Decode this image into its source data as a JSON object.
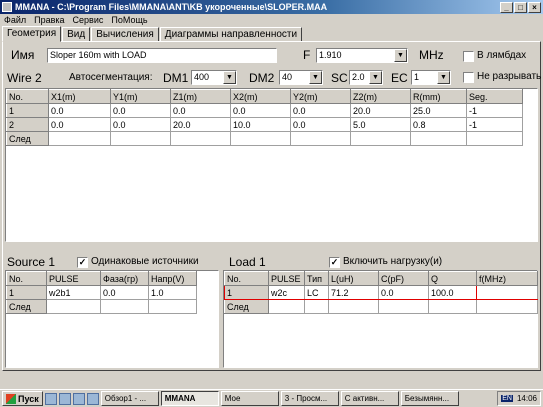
{
  "window": {
    "title": "MMANA - C:\\Program Files\\MMANA\\ANT\\KB укороченные\\SLOPER.MAA",
    "minimize": "_",
    "maximize": "□",
    "close": "×"
  },
  "menu": [
    "Файл",
    "Правка",
    "Сервис",
    "ПоМощь"
  ],
  "tabs": [
    "Геометрия",
    "Вид",
    "Вычисления",
    "Диаграммы направленности"
  ],
  "geometry": {
    "name_label": "Имя",
    "name_value": "Sloper 160m with LOAD",
    "f_label": "F",
    "f_value": "1.910",
    "mhz_label": "MHz",
    "lambda_label": "В лямбдах",
    "wire_label": "Wire 2",
    "autoseg_label": "Автосегментация:",
    "dm1_label": "DM1",
    "dm1_value": "400",
    "dm2_label": "DM2",
    "dm2_value": "40",
    "sc_label": "SC",
    "sc_value": "2.0",
    "ec_label": "EC",
    "ec_value": "1",
    "nobreak_label": "Не разрывать"
  },
  "wires": {
    "headers": [
      "No.",
      "X1(m)",
      "Y1(m)",
      "Z1(m)",
      "X2(m)",
      "Y2(m)",
      "Z2(m)",
      "R(mm)",
      "Seg."
    ],
    "rows": [
      [
        "1",
        "0.0",
        "0.0",
        "0.0",
        "0.0",
        "0.0",
        "20.0",
        "25.0",
        "-1"
      ],
      [
        "2",
        "0.0",
        "0.0",
        "20.0",
        "10.0",
        "0.0",
        "5.0",
        "0.8",
        "-1"
      ]
    ],
    "next_label": "След"
  },
  "source": {
    "label": "Source 1",
    "same_label": "Одинаковые источники",
    "headers": [
      "No.",
      "PULSE",
      "Фаза(гр)",
      "Напр(V)"
    ],
    "rows": [
      [
        "1",
        "w2b1",
        "0.0",
        "1.0"
      ]
    ],
    "next_label": "След"
  },
  "load": {
    "label": "Load  1",
    "enable_label": "Включить нагрузку(и)",
    "headers": [
      "No.",
      "PULSE",
      "Тип",
      "L(uH)",
      "C(pF)",
      "Q",
      "f(MHz)"
    ],
    "rows": [
      [
        "1",
        "w2c",
        "LC",
        "71.2",
        "0.0",
        "100.0",
        ""
      ]
    ],
    "next_label": "След"
  },
  "taskbar": {
    "start": "Пуск",
    "tasks": [
      "Обзор1 - ...",
      "MMANA",
      "Мое",
      "3 - Просм...",
      "С активн...",
      "Безымянн..."
    ],
    "lang": "EN",
    "clock": "14:06"
  }
}
